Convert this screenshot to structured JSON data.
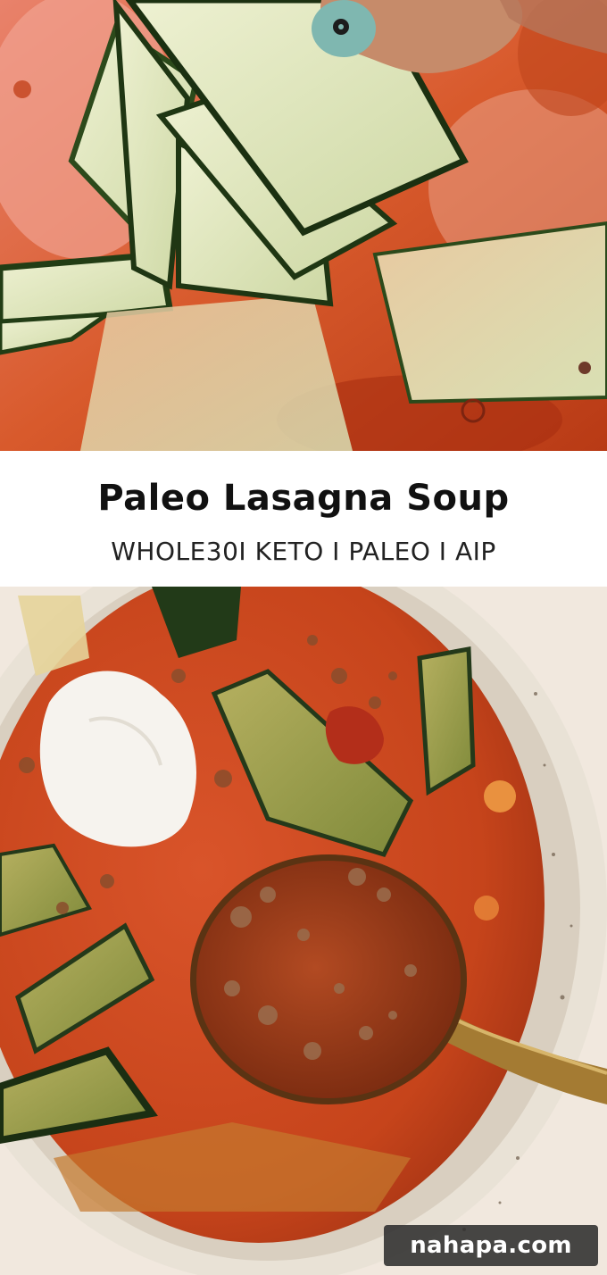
{
  "pin": {
    "title": "Paleo Lasagna Soup",
    "subtitle": "WHOLE30I KETO I PALEO I AIP",
    "watermark": "nahapa.com"
  },
  "photos": {
    "top": {
      "name": "zucchini-noodles-in-tomato-broth"
    },
    "bottom": {
      "name": "lasagna-soup-bowl-with-spoon"
    }
  },
  "colors": {
    "broth": "#c9461c",
    "broth_light": "#e8835a",
    "zucchini_skin": "#2f4a1e",
    "zucchini_flesh": "#dfe6c0",
    "bowl": "#ece5d9",
    "background": "#f2e9df",
    "spoon": "#b08a3c"
  }
}
